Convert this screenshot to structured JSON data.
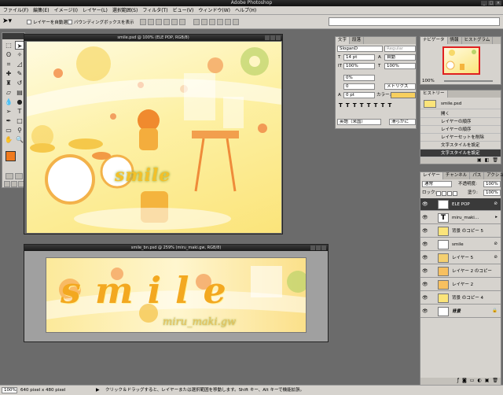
{
  "window": {
    "title": "Adobe Photoshop"
  },
  "menu": [
    "ファイル(F)",
    "編集(E)",
    "イメージ(I)",
    "レイヤー(L)",
    "選択範囲(S)",
    "フィルタ(T)",
    "ビュー(V)",
    "ウィンドウ(W)",
    "ヘルプ(H)"
  ],
  "options": {
    "auto_select": "レイヤーを自動選択",
    "bounding_box": "バウンディングボックスを表示"
  },
  "doc1": {
    "title": "smile.psd @ 100% (ELE POP, RGB/8)",
    "logo_text": "smile"
  },
  "doc2": {
    "title": "smile_bn.psd @ 259% (miru_maki.gw, RGB/8)",
    "logo_text": "smile",
    "sub_text": "miru_maki.gw"
  },
  "character": {
    "tabs": [
      "文字",
      "段落"
    ],
    "font": "SloganD",
    "style": "Regular",
    "size": "14 pt",
    "leading": "自動",
    "vscale": "100%",
    "hscale": "100%",
    "tracking_ratio": "0%",
    "kerning": "0",
    "kerning_mode": "メトリクス",
    "baseline": "0 pt",
    "color_label": "カラー:",
    "color": "#f7cf5e",
    "language": "英語（米国）",
    "aa_mode": "滑らかに"
  },
  "navigator": {
    "tabs": [
      "ナビゲータ",
      "情報",
      "ヒストグラム"
    ],
    "zoom": "100%"
  },
  "history": {
    "tab": "ヒストリー",
    "snapshot": "smile.psd",
    "items": [
      "開く",
      "レイヤーの順序",
      "レイヤーの順序",
      "レイヤーセットを削除",
      "文字スタイルを設定",
      "文字スタイルを設定"
    ]
  },
  "layers": {
    "tabs": [
      "レイヤー",
      "チャンネル",
      "パス",
      "アクション"
    ],
    "blend": "通常",
    "opacity_label": "不透明度:",
    "opacity": "100%",
    "lock_label": "ロック:",
    "fill_label": "塗り:",
    "fill": "100%",
    "items": [
      {
        "name": "ELE POP",
        "type": "T",
        "fx": true
      },
      {
        "name": "miru_maki...",
        "type": "T",
        "fx": false
      },
      {
        "name": "背景 のコピー 5",
        "type": "img",
        "fx": false
      },
      {
        "name": "smile",
        "type": "img",
        "fx": true
      },
      {
        "name": "レイヤー 5",
        "type": "img",
        "fx": true
      },
      {
        "name": "レイヤー 2 のコピー",
        "type": "img",
        "fx": false
      },
      {
        "name": "レイヤー 2",
        "type": "img",
        "fx": false
      },
      {
        "name": "背景 のコピー 4",
        "type": "img",
        "fx": false
      },
      {
        "name": "背景",
        "type": "img",
        "fx": false
      }
    ]
  },
  "status": {
    "zoom": "100%",
    "doc_size": "640 pixel x 480 pixel",
    "hint": "クリック＆ドラッグすると、レイヤーまたは選択範囲を移動します。Shift キー、Alt キーで機能拡張。"
  },
  "colors": {
    "foreground": "#f07a1e",
    "background": "#ffffff",
    "selected_layer": "#3a3a3a"
  }
}
